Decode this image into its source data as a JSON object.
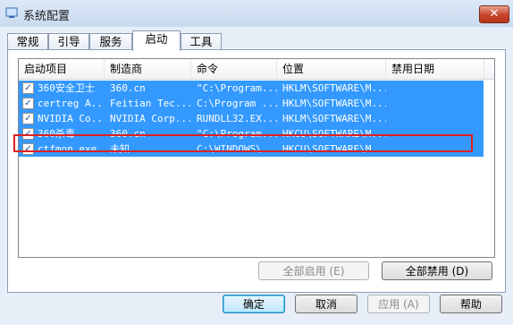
{
  "window": {
    "title": "系统配置",
    "close_label": "✕"
  },
  "tabs": [
    {
      "label": "常规"
    },
    {
      "label": "引导"
    },
    {
      "label": "服务"
    },
    {
      "label": "启动"
    },
    {
      "label": "工具"
    }
  ],
  "list": {
    "columns": [
      "启动项目",
      "制造商",
      "命令",
      "位置",
      "禁用日期"
    ],
    "rows": [
      {
        "item": "360安全卫士",
        "maker": "360.cn",
        "command": "\"C:\\Program...",
        "location": "HKLM\\SOFTWARE\\M...",
        "date": ""
      },
      {
        "item": "certreg A...",
        "maker": "Feitian Tec...",
        "command": "C:\\Program ...",
        "location": "HKLM\\SOFTWARE\\M...",
        "date": ""
      },
      {
        "item": "NVIDIA Co...",
        "maker": "NVIDIA Corp...",
        "command": "RUNDLL32.EX...",
        "location": "HKLM\\SOFTWARE\\M...",
        "date": ""
      },
      {
        "item": "360杀毒",
        "maker": "360.cn",
        "command": "\"C:\\Program...",
        "location": "HKCU\\SOFTWARE\\M...",
        "date": ""
      },
      {
        "item": "ctfmon.exe",
        "maker": "未知",
        "command": "C:\\WINDOWS\\...",
        "location": "HKCU\\SOFTWARE\\M...",
        "date": ""
      }
    ]
  },
  "panel_buttons": {
    "enable_all": "全部启用 (E)",
    "disable_all": "全部禁用 (D)"
  },
  "dialog_buttons": {
    "ok": "确定",
    "cancel": "取消",
    "apply": "应用 (A)",
    "help": "帮助"
  },
  "colors": {
    "selection": "#3399ff",
    "highlight_box": "#e02020"
  }
}
